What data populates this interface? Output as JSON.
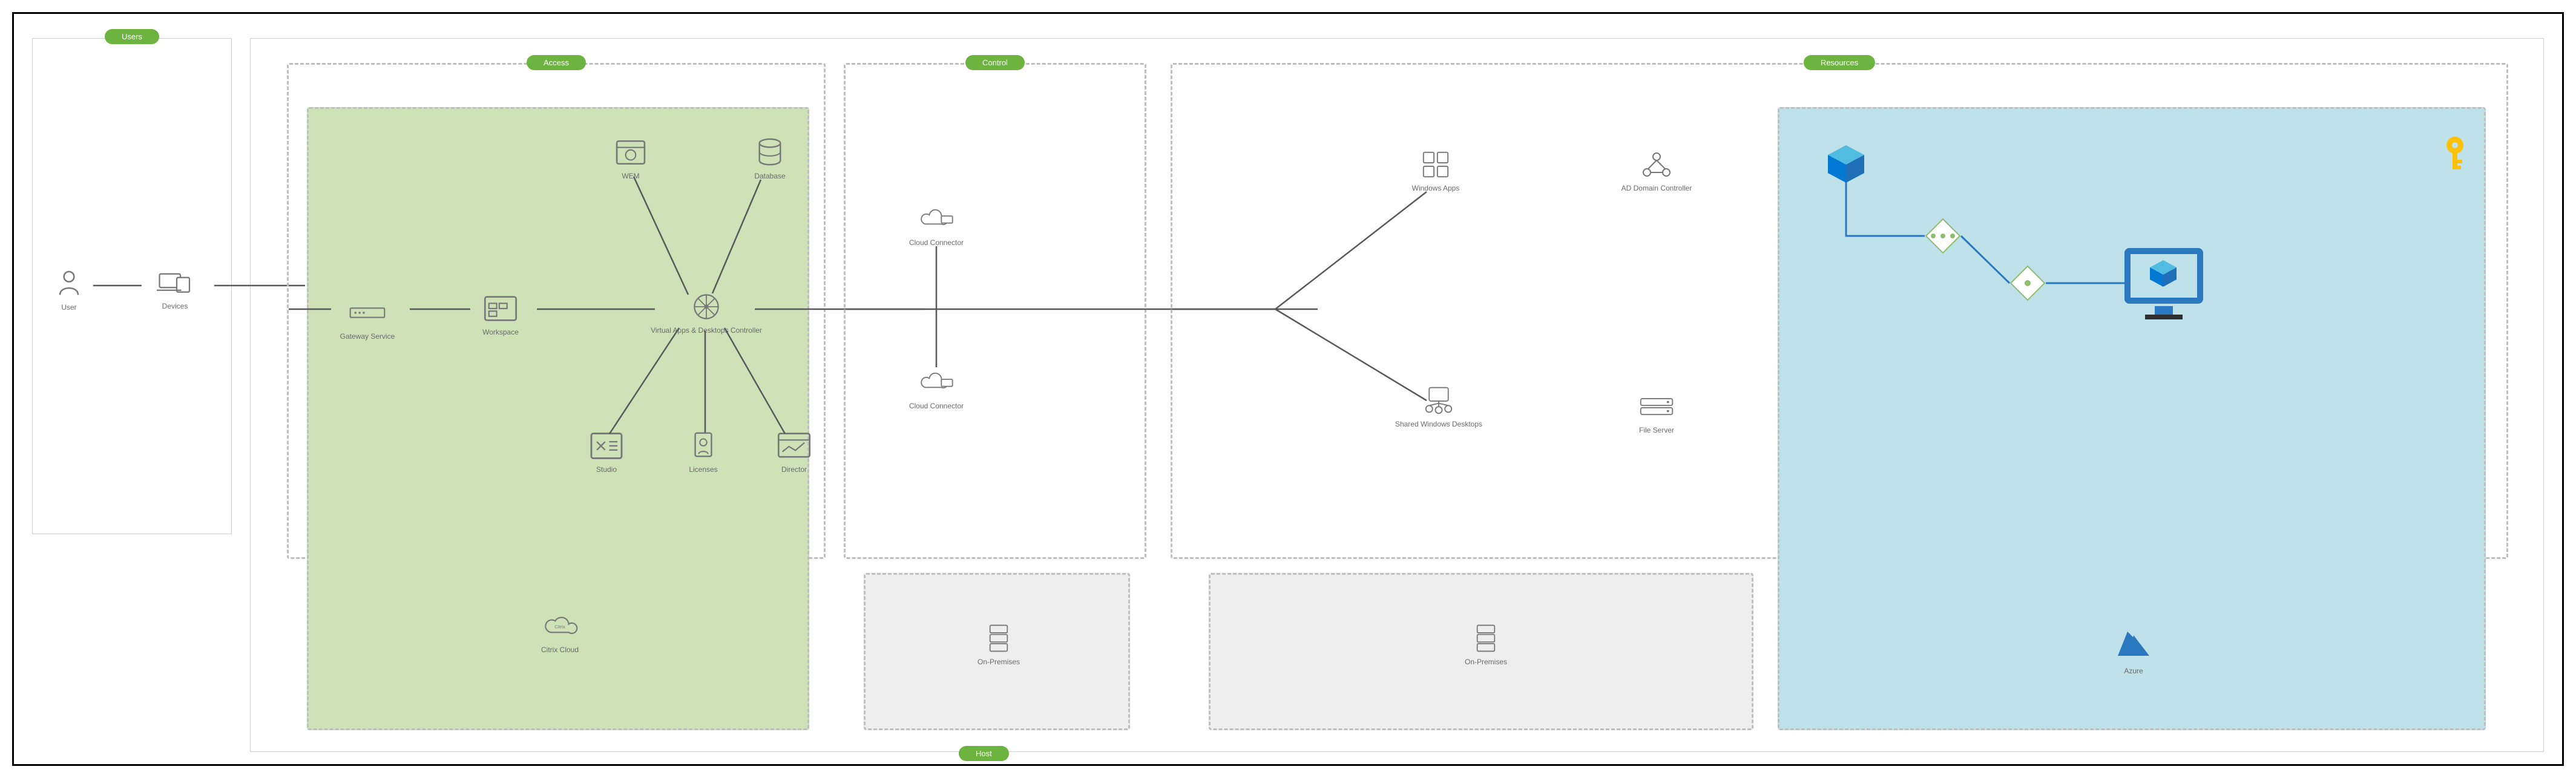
{
  "labels": {
    "users": "Users",
    "access": "Access",
    "control": "Control",
    "resources": "Resources",
    "host": "Host",
    "user": "User",
    "devices": "Devices",
    "gateway": "Gateway Service",
    "workspace": "Workspace",
    "controller": "Virtual Apps & Desktops Controller",
    "wem": "WEM",
    "database": "Database",
    "studio": "Studio",
    "licenses": "Licenses",
    "director": "Director",
    "citrixcloud": "Citrix Cloud",
    "connector": "Cloud Connector",
    "onprem": "On-Premises",
    "winapps": "Windows Apps",
    "adc": "AD Domain Controller",
    "swd": "Shared Windows Desktops",
    "fileserver": "File Server",
    "azure": "Azure"
  },
  "diagram": {
    "type": "architecture",
    "layers": [
      "Users",
      "Access",
      "Control",
      "Resources"
    ],
    "hosts": [
      "Citrix Cloud",
      "On-Premises",
      "On-Premises",
      "Azure"
    ],
    "flow": [
      "User",
      "Devices",
      "Gateway Service",
      "Workspace",
      "Virtual Apps & Desktops Controller",
      "Cloud Connector",
      "Windows Apps / Shared Windows Desktops"
    ],
    "controller_links": [
      "WEM",
      "Database",
      "Studio",
      "Licenses",
      "Director"
    ],
    "resource_services": [
      "Windows Apps",
      "AD Domain Controller",
      "Shared Windows Desktops",
      "File Server"
    ]
  }
}
